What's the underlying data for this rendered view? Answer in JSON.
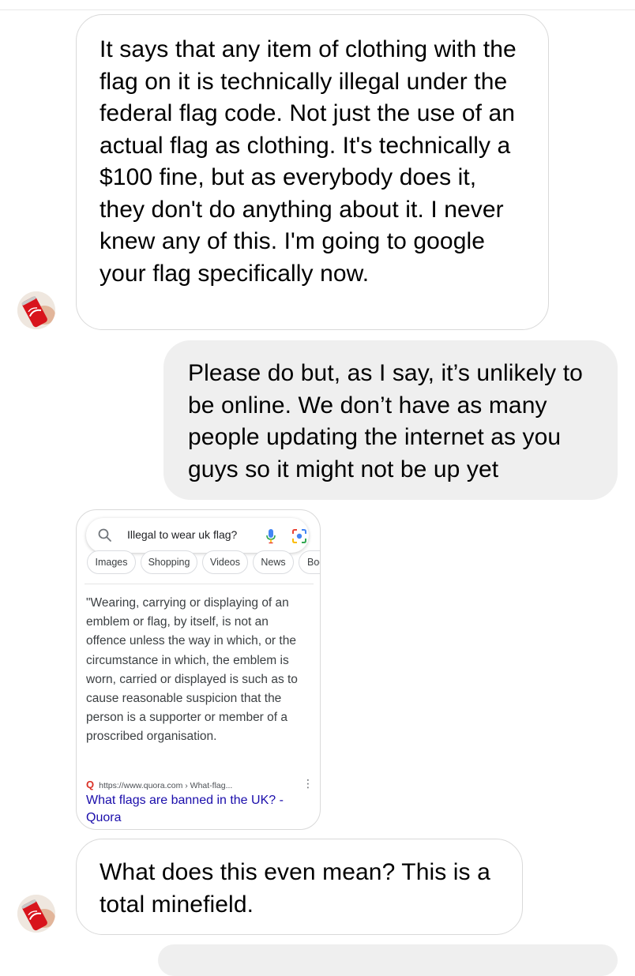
{
  "messages": {
    "m1": {
      "text": "It says that any item of clothing with the flag on it is technically illegal under the federal flag code. Not just the use of an actual flag as clothing. It's technically a $100 fine, but as everybody does it, they don't do anything about it. I never knew any of this. I'm going to google your flag specifically now."
    },
    "m2": {
      "text": "Please do but, as I say, it’s unlikely to be online. We don’t have as many people updating the internet as you guys so it might not be up yet"
    },
    "m4": {
      "text": "What does this even mean? This is a total minefield."
    }
  },
  "screenshot": {
    "search_query": "Illegal to wear uk flag?",
    "chips": [
      "Images",
      "Shopping",
      "Videos",
      "News",
      "Boo"
    ],
    "quote": "\"Wearing, carrying or displaying of an emblem or flag, by itself, is not an offence unless the way in which, or the circumstance in which, the emblem is worn, carried or displayed is such as to cause reasonable suspicion that the person is a supporter or member of a proscribed organisation.",
    "source_url": "https://www.quora.com › What-flag...",
    "result_title": "What flags are banned in the UK? - Quora"
  },
  "icons": {
    "avatar": "coca-cola-can-avatar",
    "search": "search-icon",
    "mic": "mic-icon",
    "lens": "google-lens-icon"
  },
  "colors": {
    "outgoing_bubble": "#efefef",
    "link": "#1a0dab",
    "coke_red": "#d8141c"
  }
}
